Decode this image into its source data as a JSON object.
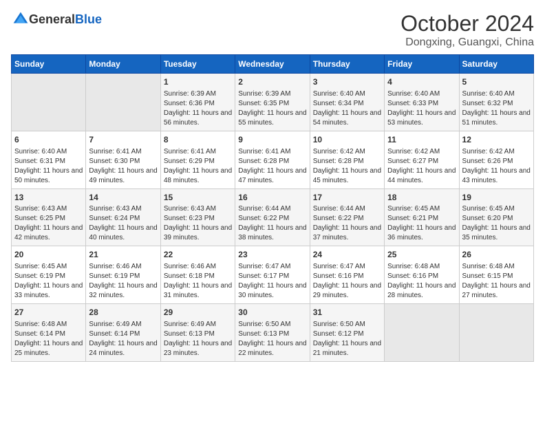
{
  "logo": {
    "text_general": "General",
    "text_blue": "Blue"
  },
  "title": {
    "month": "October 2024",
    "location": "Dongxing, Guangxi, China"
  },
  "headers": [
    "Sunday",
    "Monday",
    "Tuesday",
    "Wednesday",
    "Thursday",
    "Friday",
    "Saturday"
  ],
  "weeks": [
    [
      {
        "day": "",
        "info": ""
      },
      {
        "day": "",
        "info": ""
      },
      {
        "day": "1",
        "info": "Sunrise: 6:39 AM\nSunset: 6:36 PM\nDaylight: 11 hours and 56 minutes."
      },
      {
        "day": "2",
        "info": "Sunrise: 6:39 AM\nSunset: 6:35 PM\nDaylight: 11 hours and 55 minutes."
      },
      {
        "day": "3",
        "info": "Sunrise: 6:40 AM\nSunset: 6:34 PM\nDaylight: 11 hours and 54 minutes."
      },
      {
        "day": "4",
        "info": "Sunrise: 6:40 AM\nSunset: 6:33 PM\nDaylight: 11 hours and 53 minutes."
      },
      {
        "day": "5",
        "info": "Sunrise: 6:40 AM\nSunset: 6:32 PM\nDaylight: 11 hours and 51 minutes."
      }
    ],
    [
      {
        "day": "6",
        "info": "Sunrise: 6:40 AM\nSunset: 6:31 PM\nDaylight: 11 hours and 50 minutes."
      },
      {
        "day": "7",
        "info": "Sunrise: 6:41 AM\nSunset: 6:30 PM\nDaylight: 11 hours and 49 minutes."
      },
      {
        "day": "8",
        "info": "Sunrise: 6:41 AM\nSunset: 6:29 PM\nDaylight: 11 hours and 48 minutes."
      },
      {
        "day": "9",
        "info": "Sunrise: 6:41 AM\nSunset: 6:28 PM\nDaylight: 11 hours and 47 minutes."
      },
      {
        "day": "10",
        "info": "Sunrise: 6:42 AM\nSunset: 6:28 PM\nDaylight: 11 hours and 45 minutes."
      },
      {
        "day": "11",
        "info": "Sunrise: 6:42 AM\nSunset: 6:27 PM\nDaylight: 11 hours and 44 minutes."
      },
      {
        "day": "12",
        "info": "Sunrise: 6:42 AM\nSunset: 6:26 PM\nDaylight: 11 hours and 43 minutes."
      }
    ],
    [
      {
        "day": "13",
        "info": "Sunrise: 6:43 AM\nSunset: 6:25 PM\nDaylight: 11 hours and 42 minutes."
      },
      {
        "day": "14",
        "info": "Sunrise: 6:43 AM\nSunset: 6:24 PM\nDaylight: 11 hours and 40 minutes."
      },
      {
        "day": "15",
        "info": "Sunrise: 6:43 AM\nSunset: 6:23 PM\nDaylight: 11 hours and 39 minutes."
      },
      {
        "day": "16",
        "info": "Sunrise: 6:44 AM\nSunset: 6:22 PM\nDaylight: 11 hours and 38 minutes."
      },
      {
        "day": "17",
        "info": "Sunrise: 6:44 AM\nSunset: 6:22 PM\nDaylight: 11 hours and 37 minutes."
      },
      {
        "day": "18",
        "info": "Sunrise: 6:45 AM\nSunset: 6:21 PM\nDaylight: 11 hours and 36 minutes."
      },
      {
        "day": "19",
        "info": "Sunrise: 6:45 AM\nSunset: 6:20 PM\nDaylight: 11 hours and 35 minutes."
      }
    ],
    [
      {
        "day": "20",
        "info": "Sunrise: 6:45 AM\nSunset: 6:19 PM\nDaylight: 11 hours and 33 minutes."
      },
      {
        "day": "21",
        "info": "Sunrise: 6:46 AM\nSunset: 6:19 PM\nDaylight: 11 hours and 32 minutes."
      },
      {
        "day": "22",
        "info": "Sunrise: 6:46 AM\nSunset: 6:18 PM\nDaylight: 11 hours and 31 minutes."
      },
      {
        "day": "23",
        "info": "Sunrise: 6:47 AM\nSunset: 6:17 PM\nDaylight: 11 hours and 30 minutes."
      },
      {
        "day": "24",
        "info": "Sunrise: 6:47 AM\nSunset: 6:16 PM\nDaylight: 11 hours and 29 minutes."
      },
      {
        "day": "25",
        "info": "Sunrise: 6:48 AM\nSunset: 6:16 PM\nDaylight: 11 hours and 28 minutes."
      },
      {
        "day": "26",
        "info": "Sunrise: 6:48 AM\nSunset: 6:15 PM\nDaylight: 11 hours and 27 minutes."
      }
    ],
    [
      {
        "day": "27",
        "info": "Sunrise: 6:48 AM\nSunset: 6:14 PM\nDaylight: 11 hours and 25 minutes."
      },
      {
        "day": "28",
        "info": "Sunrise: 6:49 AM\nSunset: 6:14 PM\nDaylight: 11 hours and 24 minutes."
      },
      {
        "day": "29",
        "info": "Sunrise: 6:49 AM\nSunset: 6:13 PM\nDaylight: 11 hours and 23 minutes."
      },
      {
        "day": "30",
        "info": "Sunrise: 6:50 AM\nSunset: 6:13 PM\nDaylight: 11 hours and 22 minutes."
      },
      {
        "day": "31",
        "info": "Sunrise: 6:50 AM\nSunset: 6:12 PM\nDaylight: 11 hours and 21 minutes."
      },
      {
        "day": "",
        "info": ""
      },
      {
        "day": "",
        "info": ""
      }
    ]
  ]
}
